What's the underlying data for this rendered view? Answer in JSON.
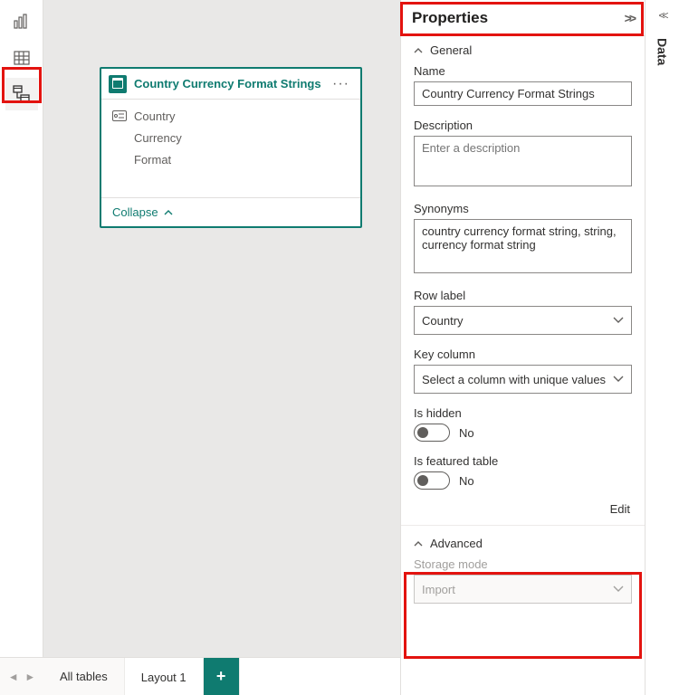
{
  "leftRail": {
    "items": [
      "report-view",
      "data-view",
      "model-view"
    ]
  },
  "canvas": {
    "table": {
      "title": "Country Currency Format Strings",
      "fields": [
        "Country",
        "Currency",
        "Format"
      ],
      "collapse_label": "Collapse"
    }
  },
  "bottomBar": {
    "tabs": {
      "all": "All tables",
      "layout1": "Layout 1"
    }
  },
  "properties": {
    "header": "Properties",
    "sections": {
      "general": "General",
      "advanced": "Advanced"
    },
    "name": {
      "label": "Name",
      "value": "Country Currency Format Strings"
    },
    "description": {
      "label": "Description",
      "placeholder": "Enter a description",
      "value": ""
    },
    "synonyms": {
      "label": "Synonyms",
      "value": "country currency format string, string, currency format string"
    },
    "rowLabel": {
      "label": "Row label",
      "value": "Country"
    },
    "keyColumn": {
      "label": "Key column",
      "value": "Select a column with unique values"
    },
    "isHidden": {
      "label": "Is hidden",
      "status": "No"
    },
    "isFeatured": {
      "label": "Is featured table",
      "status": "No"
    },
    "edit_label": "Edit",
    "storageMode": {
      "label": "Storage mode",
      "value": "Import"
    }
  },
  "rightRail": {
    "label": "Data"
  }
}
